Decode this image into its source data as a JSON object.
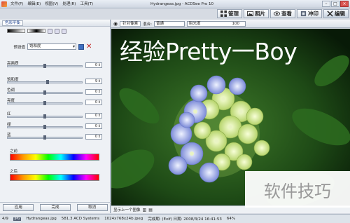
{
  "titlebar": {
    "title": "Hydrangeas.jpg - ACDSee Pro 10",
    "menus": [
      "文件(F)",
      "编辑(E)",
      "视图(V)",
      "处理(R)",
      "工具(T)"
    ]
  },
  "modes": [
    {
      "label": "管理",
      "icon": "manage-grid-icon"
    },
    {
      "label": "照片",
      "icon": "photo-icon"
    },
    {
      "label": "查看",
      "icon": "eye-icon"
    },
    {
      "label": "冲印",
      "icon": "develop-icon"
    },
    {
      "label": "编辑",
      "icon": "edit-icon"
    }
  ],
  "panel": {
    "tab": "色彩平衡",
    "preset_label": "预设值",
    "preset_value": "饱和度",
    "sliders": [
      {
        "label": "高画质",
        "value": "0",
        "level": 0.5
      },
      {
        "label": "饱和度",
        "value": "9",
        "level": 0.54
      },
      {
        "label": "色调",
        "value": "0",
        "level": 0.5
      },
      {
        "label": "亮度",
        "value": "0",
        "level": 0.5
      }
    ],
    "rgb_sliders": [
      {
        "label": "红",
        "value": "0",
        "level": 0.5
      },
      {
        "label": "绿",
        "value": "0",
        "level": 0.5
      },
      {
        "label": "蓝",
        "value": "0",
        "level": 0.5
      }
    ],
    "before_label": "之前",
    "after_label": "之后",
    "buttons": {
      "apply": "应用",
      "done": "完成",
      "cancel": "取消"
    }
  },
  "edit_toolbar": {
    "target_button": "针对像素",
    "mix_label": "混合:",
    "mix_value": "普通",
    "opacity_label": "阻光度",
    "opacity_value": "100"
  },
  "photo": {
    "overlay_text": "经验Pretty一Boy"
  },
  "bottom_strip": {
    "label": "显示上一个图像"
  },
  "status": {
    "index": "4/9",
    "badge": "JPG",
    "filename": "Hydrangeas.jpg",
    "size": "581.3 ACD Systems",
    "dimensions": "1024x768x24b jpeg",
    "date": "完成期: (Exif) 日期: 2008/3/24 16:41:53",
    "zoom": "64%"
  },
  "watermark": "软件技巧",
  "colors": {
    "accent": "#3f6fbf",
    "delete": "#c0201c"
  }
}
